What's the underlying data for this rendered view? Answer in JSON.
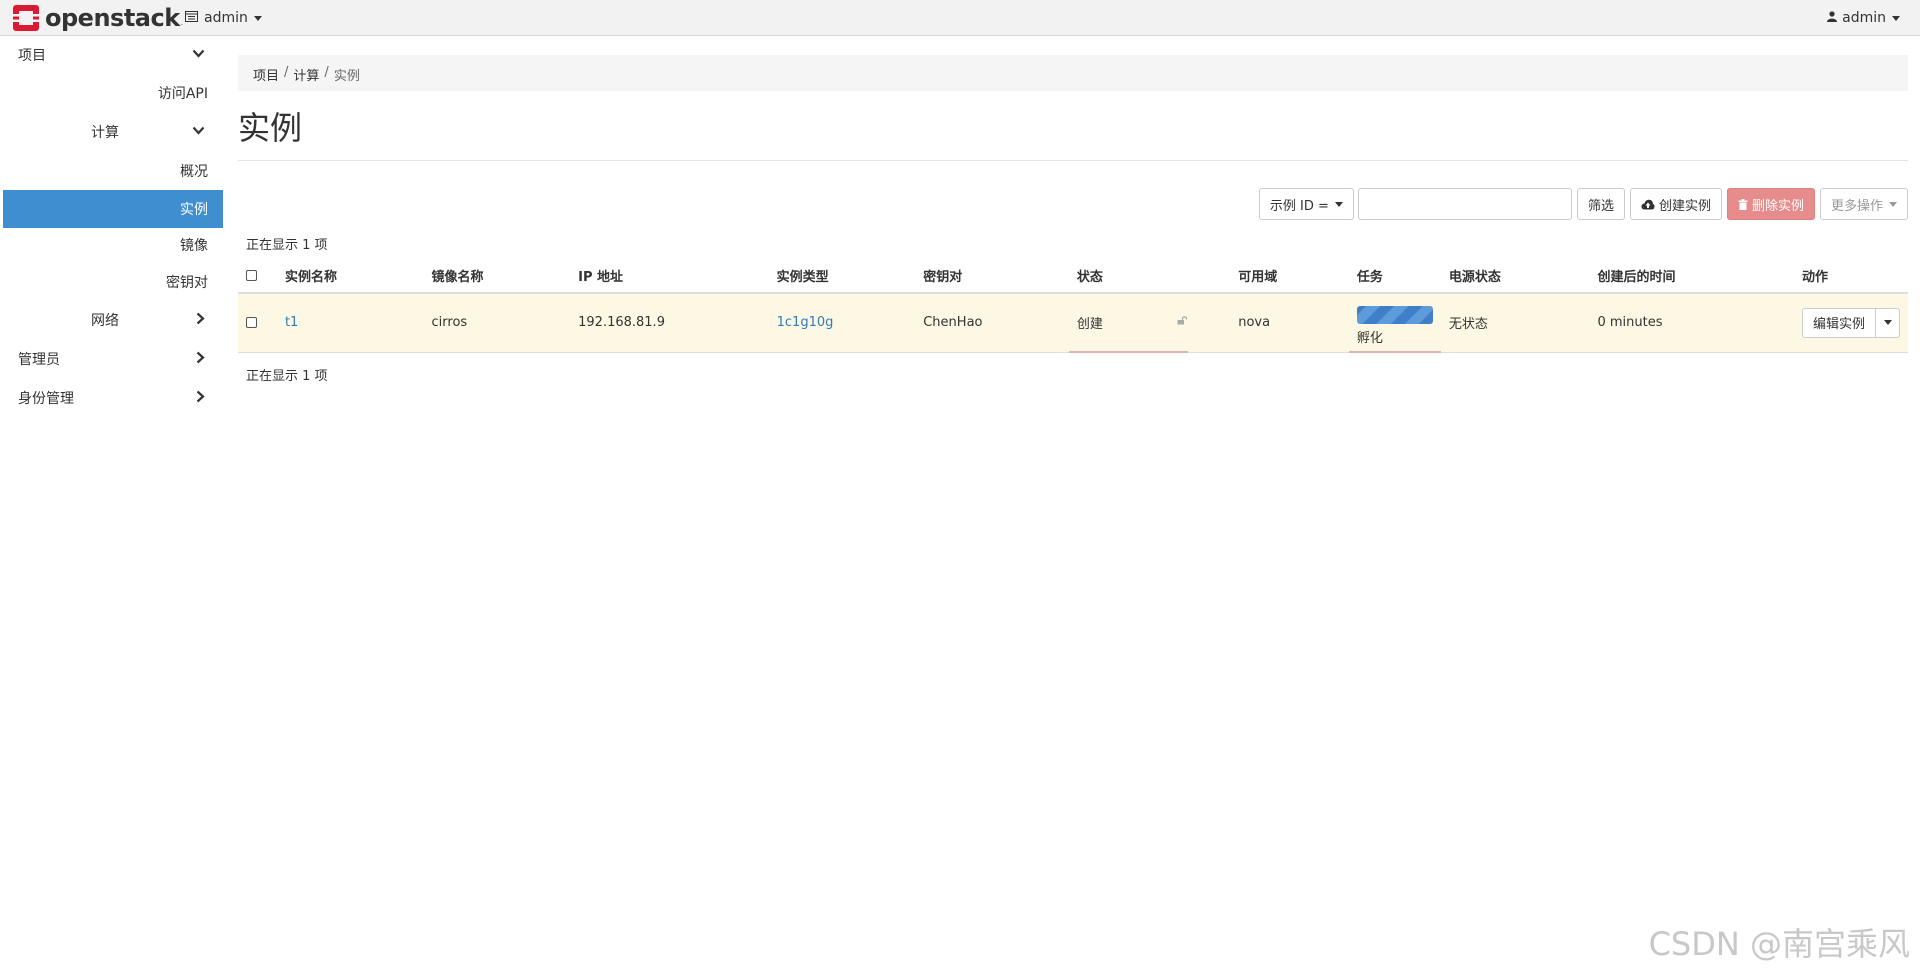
{
  "navbar": {
    "brand": "openstack",
    "brand_mark": ".",
    "project": "admin",
    "user": "admin",
    "colors": {
      "logo_red": "#da1a32"
    }
  },
  "sidebar": {
    "project": "项目",
    "access_api": "访问API",
    "compute": "计算",
    "overview": "概况",
    "instances": "实例",
    "images": "镜像",
    "keypairs": "密钥对",
    "network": "网络",
    "admin": "管理员",
    "identity": "身份管理",
    "active_color": "#3e8ed0"
  },
  "breadcrumb": [
    "项目",
    "计算",
    "实例"
  ],
  "page": {
    "title": "实例",
    "count_top": "正在显示 1 项",
    "count_bottom": "正在显示 1 项"
  },
  "toolbar": {
    "filter_field": "示例 ID =",
    "filter_value": "",
    "filter_btn": "筛选",
    "create_btn": "创建实例",
    "delete_btn": "删除实例",
    "more_btn": "更多操作"
  },
  "table": {
    "headers": [
      "实例名称",
      "镜像名称",
      "IP 地址",
      "实例类型",
      "密钥对",
      "状态",
      "可用域",
      "任务",
      "电源状态",
      "创建后的时间",
      "动作"
    ],
    "rows": [
      {
        "name": "t1",
        "image": "cirros",
        "ip": "192.168.81.9",
        "flavor": "1c1g10g",
        "keypair": "ChenHao",
        "status": "创建",
        "zone": "nova",
        "task": "孵化",
        "power": "无状态",
        "age": "0 minutes",
        "action": "编辑实例"
      }
    ]
  },
  "watermark": "CSDN @南宫乘风"
}
